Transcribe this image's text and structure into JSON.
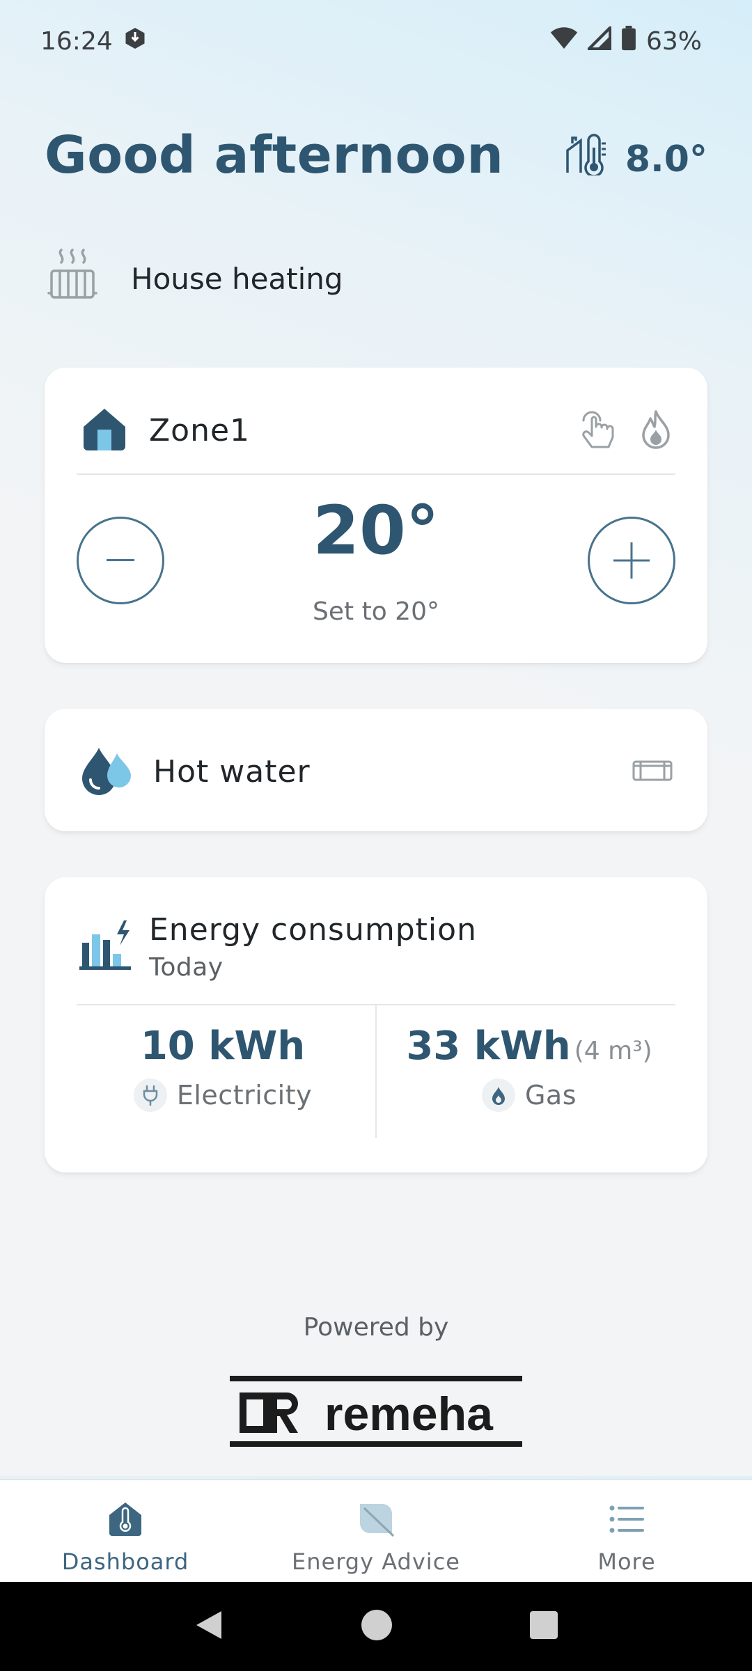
{
  "status_bar": {
    "time": "16:24",
    "battery": "63%"
  },
  "header": {
    "greeting": "Good afternoon",
    "outdoor_temp": "8.0°"
  },
  "heating": {
    "label": "House heating"
  },
  "zone": {
    "name": "Zone1",
    "temperature": "20°",
    "setpoint_text": "Set to 20°"
  },
  "hot_water": {
    "label": "Hot water"
  },
  "energy": {
    "title": "Energy consumption",
    "period": "Today",
    "electricity_value": "10 kWh",
    "electricity_label": "Electricity",
    "gas_value": "33 kWh",
    "gas_volume": "(4 m³)",
    "gas_label": "Gas"
  },
  "footer": {
    "powered_by": "Powered by",
    "brand": "remeha"
  },
  "bottom_nav": {
    "items": [
      {
        "label": "Dashboard",
        "icon": "thermometer-icon",
        "active": true
      },
      {
        "label": "Energy Advice",
        "icon": "leaf-icon",
        "active": false
      },
      {
        "label": "More",
        "icon": "list-icon",
        "active": false
      }
    ]
  },
  "colors": {
    "primary": "#2e5670",
    "accent_light": "#7cc6e8",
    "text": "#21262a",
    "muted": "#6b7075"
  }
}
